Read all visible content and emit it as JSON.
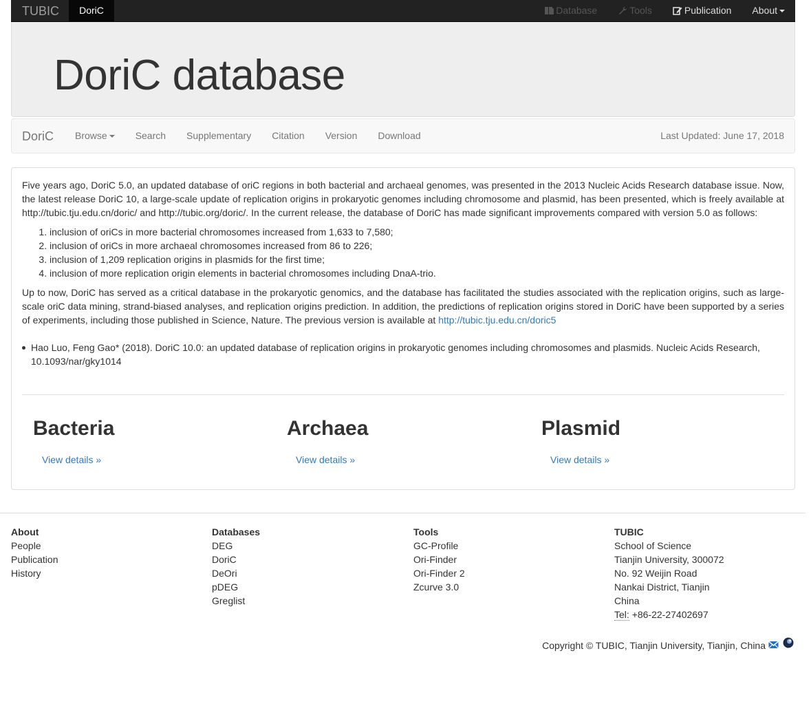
{
  "topbar": {
    "brand": "TUBIC",
    "active": "DoriC",
    "links": [
      {
        "label": "Database",
        "icon": "database-icon",
        "disabled": true
      },
      {
        "label": "Tools",
        "icon": "wrench-icon",
        "disabled": true
      },
      {
        "label": "Publication",
        "icon": "edit-icon",
        "disabled": false
      },
      {
        "label": "About",
        "icon": "caret-down-icon",
        "disabled": false
      }
    ]
  },
  "jumbotron": {
    "title": "DoriC database"
  },
  "subnav": {
    "brand": "DoriC",
    "links": [
      "Browse",
      "Search",
      "Supplementary",
      "Citation",
      "Version",
      "Download"
    ],
    "updated": "Last Updated: June 17, 2018"
  },
  "intro": {
    "p1": "Five years ago, DoriC 5.0, an updated database of oriC regions in both bacterial and archaeal genomes, was presented in the 2013 Nucleic Acids Research database issue. Now, the latest release DoriC 10, a large-scale update of replication origins in prokaryotic genomes including chromosome and plasmid, has been presented, which is freely available at http://tubic.tju.edu.cn/doric/ and http://tubic.org/doric/. In the current release, the database of DoriC has made significant improvements compared with version 5.0 as follows:",
    "items": [
      "inclusion of oriCs in more bacterial chromosomes increased from 1,633 to 7,580;",
      "inclusion of oriCs in more archaeal chromosomes increased from 86 to 226;",
      "inclusion of 1,209 replication origins in plasmids for the first time;",
      "inclusion of more replication origin elements in bacterial chromosomes including DnaA-trio."
    ],
    "p2": "Up to now, DoriC has served as a critical database in the prokaryotic genomics, and the database has facilitated the studies associated with the replication origins, such as large-scale oriC data mining, strand-biased analyses, and replication origins prediction. In addition, the predictions of replication origins stored in DoriC have been supported by a series of experiments, including those published in Science, Nature. The previous version is available at",
    "p2_link": "http://tubic.tju.edu.cn/doric5",
    "citation": "Hao Luo, Feng Gao* (2018). DoriC 10.0: an updated database of replication origins in prokaryotic genomes including chromosomes and plasmids. Nucleic Acids Research, 10.1093/nar/gky1014"
  },
  "sections": [
    {
      "title": "Bacteria",
      "link": "View details »"
    },
    {
      "title": "Archaea",
      "link": "View details »"
    },
    {
      "title": "Plasmid",
      "link": "View details »"
    }
  ],
  "footer": {
    "about": {
      "heading": "About",
      "items": [
        "People",
        "Publication",
        "History"
      ]
    },
    "databases": {
      "heading": "Databases",
      "items": [
        "DEG",
        "DoriC",
        "DeOri",
        "pDEG",
        "Greglist"
      ]
    },
    "tools": {
      "heading": "Tools",
      "items": [
        "GC-Profile",
        "Ori-Finder",
        "Ori-Finder 2",
        "Zcurve 3.0"
      ]
    },
    "tubic": {
      "heading": "TUBIC",
      "lines": [
        "School of Science",
        "Tianjin University, 300072",
        "No. 92 Weijin Road",
        "Nankai District, Tianjin",
        "China"
      ],
      "tel_label": "Tel:",
      "tel": "+86-22-27402697"
    },
    "copyright": "Copyright © TUBIC, Tianjin University, Tianjin, China"
  }
}
